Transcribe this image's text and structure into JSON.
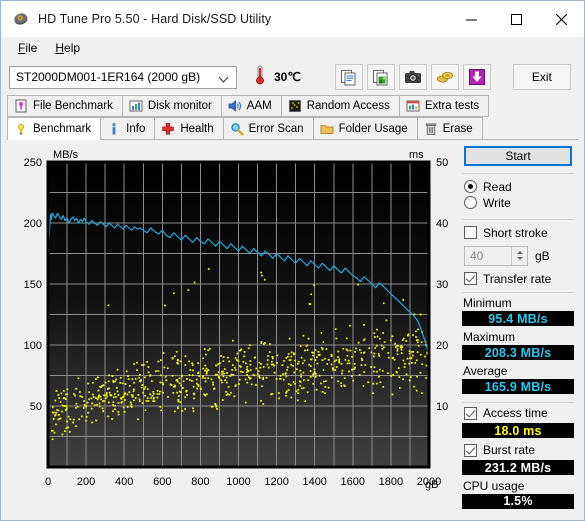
{
  "window": {
    "title": "HD Tune Pro 5.50 - Hard Disk/SSD Utility",
    "icon": "hdtune-app-icon",
    "minimize": "─",
    "maximize": "☐",
    "close": "✕"
  },
  "menu": [
    {
      "label": "File",
      "mnemonic": "F"
    },
    {
      "label": "Help",
      "mnemonic": "H"
    }
  ],
  "toolbar": {
    "drive": "ST2000DM001-1ER164 (2000 gB)",
    "temperature": "30℃",
    "temperature_icon": "thermometer-icon",
    "buttons": [
      {
        "name": "copy-text-icon",
        "tooltip": "Copy text"
      },
      {
        "name": "copy-image-icon",
        "tooltip": "Copy image"
      },
      {
        "name": "screenshot-camera-icon",
        "tooltip": "Save screenshot"
      },
      {
        "name": "donate-coins-icon",
        "tooltip": "Donate"
      },
      {
        "name": "download-icon",
        "tooltip": "Download"
      }
    ],
    "exit_label": "Exit"
  },
  "tabs": {
    "row1": [
      {
        "label": "File Benchmark",
        "icon": "file-benchmark-icon",
        "active": false
      },
      {
        "label": "Disk monitor",
        "icon": "disk-monitor-icon",
        "active": false
      },
      {
        "label": "AAM",
        "icon": "aam-speaker-icon",
        "active": false
      },
      {
        "label": "Random Access",
        "icon": "random-access-icon",
        "active": false
      },
      {
        "label": "Extra tests",
        "icon": "extra-tests-icon",
        "active": false
      }
    ],
    "row2": [
      {
        "label": "Benchmark",
        "icon": "benchmark-icon",
        "active": true
      },
      {
        "label": "Info",
        "icon": "info-icon",
        "active": false
      },
      {
        "label": "Health",
        "icon": "health-cross-icon",
        "active": false
      },
      {
        "label": "Error Scan",
        "icon": "error-scan-magnifier-icon",
        "active": false
      },
      {
        "label": "Folder Usage",
        "icon": "folder-usage-icon",
        "active": false
      },
      {
        "label": "Erase",
        "icon": "erase-trash-icon",
        "active": false
      }
    ]
  },
  "sidebar": {
    "start_label": "Start",
    "mode": [
      {
        "label": "Read",
        "selected": true
      },
      {
        "label": "Write",
        "selected": false
      }
    ],
    "short_stroke": {
      "label": "Short stroke",
      "checked": false,
      "value": "40",
      "unit": "gB"
    },
    "transfer_rate": {
      "label": "Transfer rate",
      "checked": true
    },
    "minimum": {
      "label": "Minimum",
      "value": "95.4 MB/s"
    },
    "maximum": {
      "label": "Maximum",
      "value": "208.3 MB/s"
    },
    "average": {
      "label": "Average",
      "value": "165.9 MB/s"
    },
    "access_time": {
      "label": "Access time",
      "checked": true,
      "value": "18.0 ms"
    },
    "burst_rate": {
      "label": "Burst rate",
      "checked": true,
      "value": "231.2 MB/s"
    },
    "cpu_usage": {
      "label": "CPU usage",
      "value": "1.5%"
    }
  },
  "colors": {
    "transfer_curve": "#29a8e0",
    "access_dots": "#ffff00",
    "value_cyan": "#29c8ef",
    "value_yellow": "#ffff00",
    "value_white": "#ffffff",
    "plot_top": "#000000",
    "plot_bottom": "#3c3c3c",
    "grid": "#8c8c8c",
    "accent": "#0078d7"
  },
  "chart_data": {
    "type": "line",
    "title": "",
    "xlabel": "gB",
    "ylabel": "MB/s",
    "y2label": "ms",
    "xlim": [
      0,
      2000
    ],
    "ylim": [
      0,
      250
    ],
    "y2lim": [
      0,
      50
    ],
    "xticks": [
      0,
      200,
      400,
      600,
      800,
      1000,
      1200,
      1400,
      1600,
      1800,
      2000
    ],
    "yticks": [
      50,
      100,
      150,
      200,
      250
    ],
    "y2ticks": [
      10,
      20,
      30,
      40,
      50
    ],
    "grid": true,
    "legend": "none",
    "series": [
      {
        "name": "Transfer rate",
        "type": "line",
        "color": "#29a8e0",
        "axis": "left",
        "unit": "MB/s",
        "x": [
          3,
          6,
          10,
          14,
          18,
          22,
          30,
          40,
          50,
          60,
          70,
          80,
          90,
          100,
          110,
          120,
          130,
          140,
          150,
          160,
          170,
          180,
          190,
          200,
          215,
          230,
          245,
          260,
          275,
          290,
          305,
          320,
          335,
          350,
          365,
          380,
          395,
          410,
          425,
          440,
          455,
          470,
          485,
          500,
          520,
          540,
          560,
          580,
          600,
          620,
          640,
          660,
          680,
          700,
          720,
          740,
          760,
          780,
          800,
          820,
          840,
          860,
          880,
          900,
          920,
          940,
          960,
          980,
          1000,
          1020,
          1040,
          1060,
          1080,
          1100,
          1120,
          1140,
          1160,
          1180,
          1200,
          1220,
          1240,
          1260,
          1280,
          1300,
          1320,
          1340,
          1360,
          1380,
          1400,
          1420,
          1440,
          1460,
          1480,
          1500,
          1520,
          1540,
          1560,
          1580,
          1600,
          1620,
          1640,
          1660,
          1680,
          1700,
          1720,
          1740,
          1760,
          1780,
          1800,
          1820,
          1840,
          1860,
          1880,
          1900,
          1920,
          1940,
          1960,
          1980,
          1995
        ],
        "y": [
          185,
          186,
          200,
          207,
          203,
          208,
          206,
          204,
          208,
          205,
          203,
          206,
          202,
          204,
          200,
          203,
          205,
          202,
          204,
          200,
          203,
          201,
          204,
          201,
          199,
          202,
          200,
          198,
          201,
          199,
          197,
          200,
          198,
          196,
          199,
          197,
          195,
          198,
          196,
          194,
          197,
          195,
          196,
          194,
          192,
          196,
          193,
          191,
          194,
          190,
          188,
          192,
          189,
          186,
          190,
          187,
          184,
          188,
          185,
          183,
          187,
          184,
          181,
          185,
          182,
          179,
          183,
          180,
          177,
          181,
          178,
          175,
          179,
          176,
          173,
          177,
          174,
          171,
          175,
          172,
          169,
          173,
          170,
          167,
          171,
          168,
          165,
          169,
          166,
          163,
          167,
          164,
          161,
          165,
          162,
          159,
          163,
          160,
          157,
          155,
          152,
          156,
          153,
          150,
          147,
          151,
          148,
          145,
          142,
          139,
          136,
          133,
          130,
          127,
          124,
          120,
          112,
          103,
          95
        ],
        "minimum": 95.4,
        "maximum": 208.3,
        "average": 165.9
      },
      {
        "name": "Access time",
        "type": "scatter",
        "color": "#ffff00",
        "axis": "right",
        "unit": "ms",
        "average": 18.0,
        "description": "Random access-time samples scattered across the whole capacity, rising from about 3 ms near the start of the drive to roughly 25 ms toward the outer tracks, with the densest band between 10 ms and 22 ms."
      }
    ]
  }
}
